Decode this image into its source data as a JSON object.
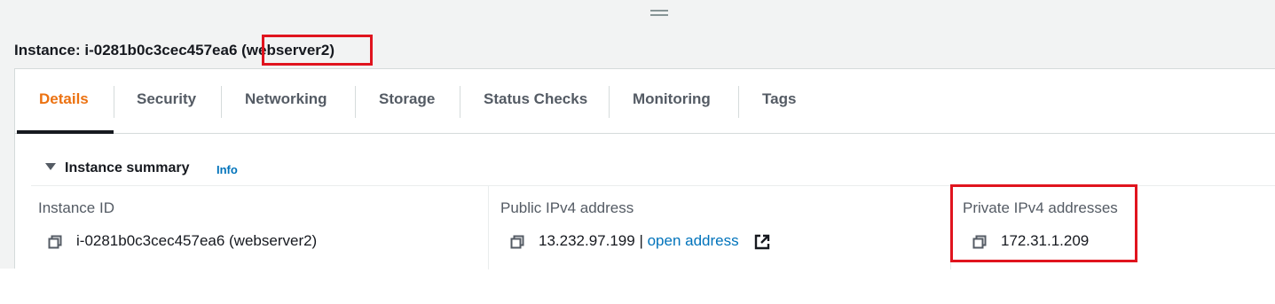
{
  "header": {
    "instance_prefix": "Instance: i-0281b0c3cec457ea6 ",
    "instance_name": "(webserver2)"
  },
  "tabs": [
    {
      "label": "Details",
      "active": true
    },
    {
      "label": "Security"
    },
    {
      "label": "Networking"
    },
    {
      "label": "Storage"
    },
    {
      "label": "Status Checks"
    },
    {
      "label": "Monitoring"
    },
    {
      "label": "Tags"
    }
  ],
  "summary": {
    "title": "Instance summary",
    "info_label": "Info"
  },
  "fields": {
    "instance_id": {
      "label": "Instance ID",
      "value": "i-0281b0c3cec457ea6 (webserver2)"
    },
    "public_ipv4": {
      "label": "Public IPv4 address",
      "value": "13.232.97.199",
      "separator": " | ",
      "link": "open address"
    },
    "private_ipv4": {
      "label": "Private IPv4 addresses",
      "value": "172.31.1.209"
    }
  },
  "colors": {
    "accent": "#ec7211",
    "link": "#0073bb",
    "highlight": "#e0141e"
  },
  "icons": [
    "drag-handle-icon",
    "caret-down-icon",
    "copy-icon",
    "external-link-icon"
  ]
}
